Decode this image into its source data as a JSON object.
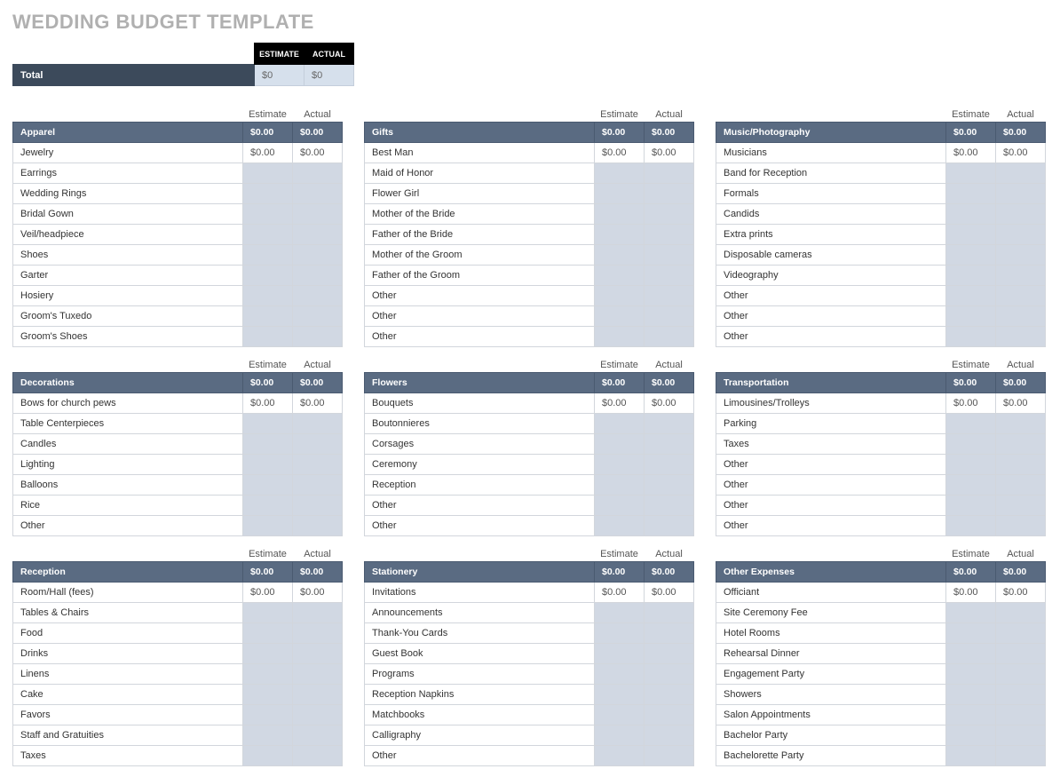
{
  "title": "WEDDING BUDGET TEMPLATE",
  "summary": {
    "estimate_header": "ESTIMATE",
    "actual_header": "ACTUAL",
    "total_label": "Total",
    "total_estimate": "$0",
    "total_actual": "$0"
  },
  "labels": {
    "estimate": "Estimate",
    "actual": "Actual",
    "zero": "$0.00"
  },
  "categories": [
    {
      "name": "Apparel",
      "items": [
        "Jewelry",
        "Earrings",
        "Wedding Rings",
        "Bridal Gown",
        "Veil/headpiece",
        "Shoes",
        "Garter",
        "Hosiery",
        "Groom's Tuxedo",
        "Groom's Shoes"
      ]
    },
    {
      "name": "Gifts",
      "items": [
        "Best Man",
        "Maid of Honor",
        "Flower Girl",
        "Mother of the Bride",
        "Father of the Bride",
        "Mother of the Groom",
        "Father of the Groom",
        "Other",
        "Other",
        "Other"
      ]
    },
    {
      "name": "Music/Photography",
      "items": [
        "Musicians",
        "Band for Reception",
        "Formals",
        "Candids",
        "Extra prints",
        "Disposable cameras",
        "Videography",
        "Other",
        "Other",
        "Other"
      ]
    },
    {
      "name": "Decorations",
      "items": [
        "Bows for church pews",
        "Table Centerpieces",
        "Candles",
        "Lighting",
        "Balloons",
        "Rice",
        "Other"
      ]
    },
    {
      "name": "Flowers",
      "items": [
        "Bouquets",
        "Boutonnieres",
        "Corsages",
        "Ceremony",
        "Reception",
        "Other",
        "Other"
      ]
    },
    {
      "name": "Transportation",
      "items": [
        "Limousines/Trolleys",
        "Parking",
        "Taxes",
        "Other",
        "Other",
        "Other",
        "Other"
      ]
    },
    {
      "name": "Reception",
      "items": [
        "Room/Hall (fees)",
        "Tables & Chairs",
        "Food",
        "Drinks",
        "Linens",
        "Cake",
        "Favors",
        "Staff and Gratuities",
        "Taxes"
      ]
    },
    {
      "name": "Stationery",
      "items": [
        "Invitations",
        "Announcements",
        "Thank-You Cards",
        "Guest Book",
        "Programs",
        "Reception Napkins",
        "Matchbooks",
        "Calligraphy",
        "Other"
      ]
    },
    {
      "name": "Other Expenses",
      "items": [
        "Officiant",
        "Site Ceremony Fee",
        "Hotel Rooms",
        "Rehearsal Dinner",
        "Engagement Party",
        "Showers",
        "Salon Appointments",
        "Bachelor Party",
        "Bachelorette Party"
      ]
    }
  ]
}
